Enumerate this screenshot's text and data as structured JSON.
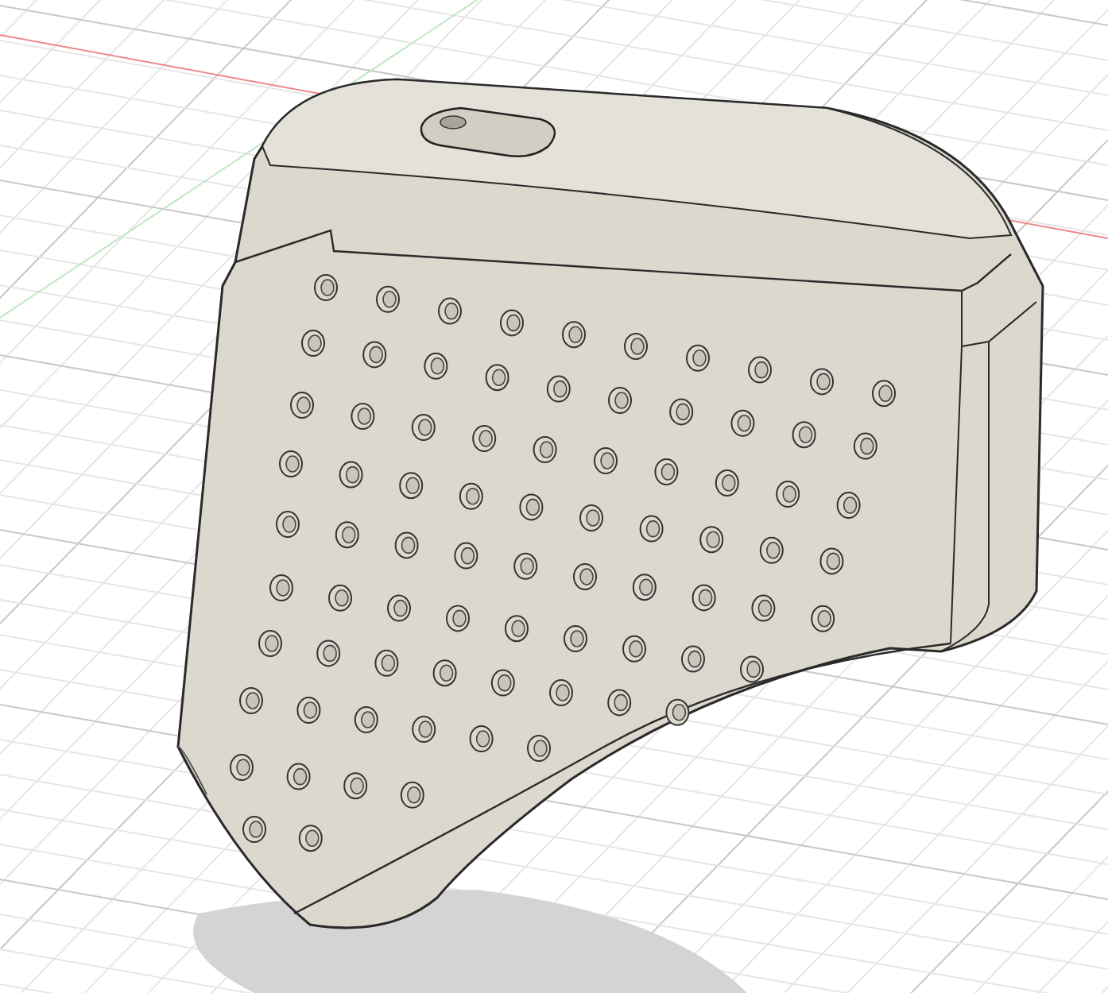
{
  "viewport": {
    "grid_visible": true,
    "shadow_visible": true
  }
}
